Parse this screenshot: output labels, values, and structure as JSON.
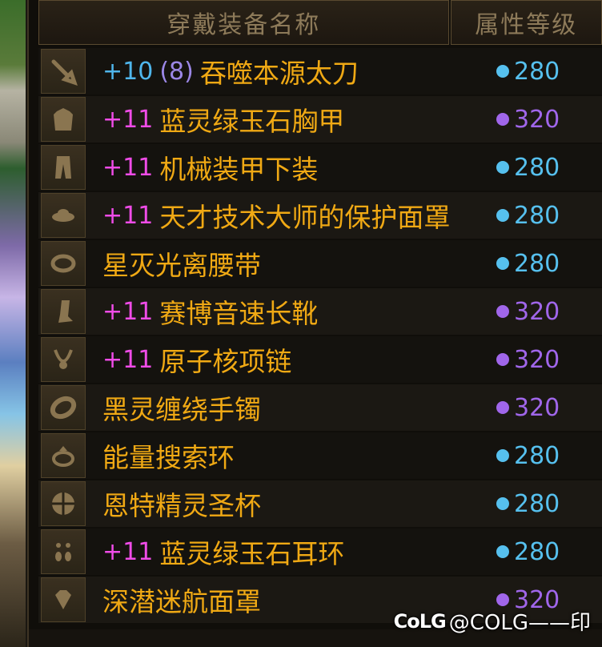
{
  "header": {
    "name_col": "穿戴装备名称",
    "level_col": "属性等级"
  },
  "colors": {
    "enh_blue": "#4fb6ec",
    "enh_pink": "#f04ce8",
    "name": "#f0a914",
    "level_cyan": "#56c0ee",
    "level_purple": "#a066ea"
  },
  "items": [
    {
      "icon": "weapon-icon",
      "enh": "+10",
      "enh_color": "blue",
      "amp": "(8)",
      "name": "吞噬本源太刀",
      "level": "280",
      "level_color": "cyan"
    },
    {
      "icon": "chest-armor-icon",
      "enh": "+11",
      "enh_color": "pink",
      "amp": "",
      "name": "蓝灵绿玉石胸甲",
      "level": "320",
      "level_color": "purple"
    },
    {
      "icon": "pants-icon",
      "enh": "+11",
      "enh_color": "pink",
      "amp": "",
      "name": "机械装甲下装",
      "level": "280",
      "level_color": "cyan"
    },
    {
      "icon": "shoulder-icon",
      "enh": "+11",
      "enh_color": "pink",
      "amp": "",
      "name": "天才技术大师的保护面罩",
      "level": "280",
      "level_color": "cyan"
    },
    {
      "icon": "belt-icon",
      "enh": "",
      "enh_color": "",
      "amp": "",
      "name": "星灭光离腰带",
      "level": "280",
      "level_color": "cyan"
    },
    {
      "icon": "boots-icon",
      "enh": "+11",
      "enh_color": "pink",
      "amp": "",
      "name": "赛博音速长靴",
      "level": "320",
      "level_color": "purple"
    },
    {
      "icon": "necklace-icon",
      "enh": "+11",
      "enh_color": "pink",
      "amp": "",
      "name": "原子核项链",
      "level": "320",
      "level_color": "purple"
    },
    {
      "icon": "bracelet-icon",
      "enh": "",
      "enh_color": "",
      "amp": "",
      "name": "黑灵缠绕手镯",
      "level": "320",
      "level_color": "purple"
    },
    {
      "icon": "ring-icon",
      "enh": "",
      "enh_color": "",
      "amp": "",
      "name": "能量搜索环",
      "level": "280",
      "level_color": "cyan"
    },
    {
      "icon": "support-icon",
      "enh": "",
      "enh_color": "",
      "amp": "",
      "name": "恩特精灵圣杯",
      "level": "280",
      "level_color": "cyan"
    },
    {
      "icon": "earring-icon",
      "enh": "+11",
      "enh_color": "pink",
      "amp": "",
      "name": "蓝灵绿玉石耳环",
      "level": "280",
      "level_color": "cyan"
    },
    {
      "icon": "magic-stone-icon",
      "enh": "",
      "enh_color": "",
      "amp": "",
      "name": "深潜迷航面罩",
      "level": "320",
      "level_color": "purple"
    }
  ],
  "watermark": {
    "logo": "CoLG",
    "text": "@COLG——印"
  }
}
